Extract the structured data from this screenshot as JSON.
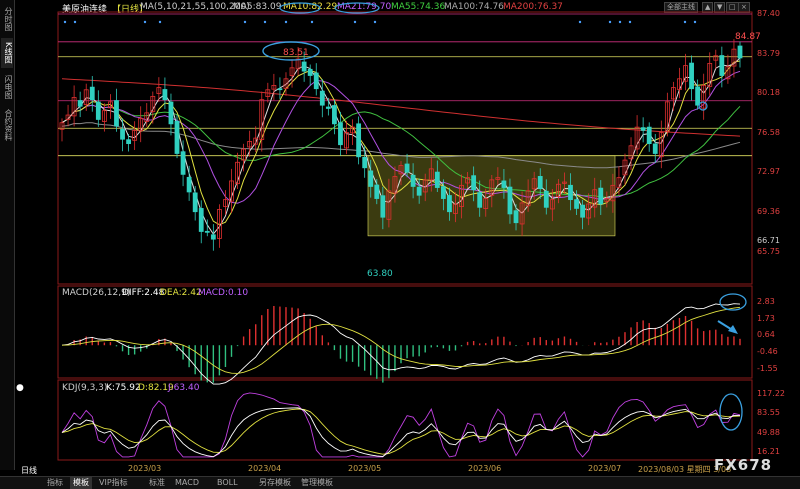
{
  "sidebar": {
    "tabs": [
      "分时图",
      "K线图",
      "闪电图",
      "合约资料"
    ],
    "active_index": 1
  },
  "header": {
    "title": "美原油连续",
    "period": "【日线】",
    "ma_label": "MA(5,10,21,55,100,200)",
    "ma_values": [
      {
        "text": "MA5:83.09",
        "color": "#cccccc"
      },
      {
        "text": "MA10:82.29",
        "color": "#f0e040"
      },
      {
        "text": "MA21:79.70",
        "color": "#c060ff"
      },
      {
        "text": "MA55:74.36",
        "color": "#40d040"
      },
      {
        "text": "MA100:74.76",
        "color": "#aaaaaa"
      },
      {
        "text": "MA200:76.37",
        "color": "#e04040"
      }
    ],
    "dropdown": "全部主线",
    "buttons": [
      "▲",
      "▼",
      "□",
      "×"
    ]
  },
  "chart_data": [
    {
      "type": "candlestick",
      "panel": "main",
      "ylim": [
        63.0,
        87.4
      ],
      "y_ticks": [
        87.4,
        83.79,
        80.18,
        76.58,
        72.97,
        69.36,
        65.75
      ],
      "x_ticks": [
        "2023/03",
        "2023/04",
        "2023/05",
        "2023/06",
        "2023/07",
        "2023/08/03 星期四 3/08"
      ],
      "current_price": 66.71,
      "annotations": [
        "83.51",
        "84.87",
        "63.80"
      ],
      "closes": [
        77.5,
        78.2,
        79.8,
        79.0,
        80.5,
        79.6,
        77.8,
        78.6,
        79.4,
        77.2,
        76.0,
        75.6,
        76.8,
        77.9,
        78.4,
        79.9,
        80.7,
        79.6,
        77.4,
        74.7,
        72.8,
        71.2,
        69.4,
        67.6,
        67.6,
        66.9,
        69.6,
        70.5,
        72.2,
        73.9,
        75.1,
        75.8,
        76.1,
        79.6,
        80.5,
        80.9,
        80.6,
        81.5,
        82.5,
        83.3,
        82.2,
        81.8,
        80.6,
        79.1,
        78.8,
        77.4,
        75.5,
        76.6,
        77.1,
        74.4,
        73.4,
        71.7,
        70.6,
        68.9,
        71.3,
        72.6,
        73.6,
        73.0,
        71.7,
        70.9,
        72.3,
        73.3,
        71.6,
        70.6,
        69.4,
        70.1,
        71.8,
        72.5,
        71.4,
        69.8,
        70.6,
        72.3,
        72.5,
        71.6,
        69.2,
        68.4,
        70.2,
        71.3,
        72.4,
        71.5,
        69.8,
        70.5,
        71.9,
        72.1,
        70.5,
        69.7,
        68.9,
        70.1,
        71.4,
        70.1,
        70.6,
        71.8,
        72.5,
        74.1,
        75.4,
        77.1,
        76.8,
        75.6,
        74.7,
        76.6,
        79.4,
        80.7,
        81.5,
        82.7,
        80.6,
        79.1,
        80.9,
        82.9,
        83.6,
        81.8,
        82.6,
        84.2,
        83.4
      ],
      "range_box": {
        "x_start": 368,
        "x_end": 615,
        "y_top": 74.5,
        "y_bottom": 67.2
      },
      "horizontal_lines": [
        {
          "y": 87.4,
          "color": "#d03080"
        },
        {
          "y": 84.87,
          "color": "#d03080"
        },
        {
          "y": 83.51,
          "color": "#e0e060"
        },
        {
          "y": 79.5,
          "color": "#d03080"
        },
        {
          "y": 77.0,
          "color": "#e0e060"
        },
        {
          "y": 74.5,
          "color": "#e0e060"
        }
      ]
    },
    {
      "type": "macd",
      "panel": "macd",
      "label": "MACD(26,12,9)",
      "values": {
        "DIFF": 2.48,
        "DEA": 2.42,
        "MACD": 0.1
      },
      "ylim": [
        -2.0,
        3.2
      ],
      "y_ticks": [
        2.83,
        1.73,
        0.64,
        -0.46,
        -1.55
      ]
    },
    {
      "type": "kdj",
      "panel": "kdj",
      "label": "KDJ(9,3,3)",
      "values": {
        "K": 75.92,
        "D": 82.19,
        "J": 63.4
      },
      "ylim": [
        5,
        125
      ],
      "y_ticks": [
        117.22,
        83.55,
        49.88,
        16.21
      ]
    }
  ],
  "bottom_tabs": [
    "日线",
    "指标",
    "模板",
    "VIP指标",
    "标准",
    "MACD",
    "BOLL",
    "另存模板",
    "管理模板"
  ],
  "bottom_active": 2,
  "watermark": "FX678",
  "colors": {
    "up": "#e03030",
    "down": "#30d0c0",
    "bg": "#000000",
    "box": "#6b6b1e"
  }
}
